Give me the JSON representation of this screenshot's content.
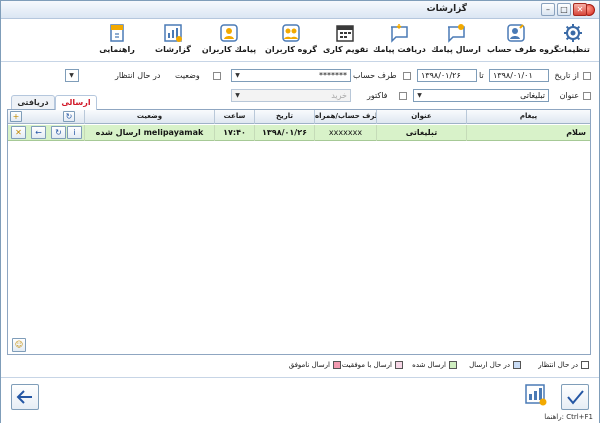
{
  "window": {
    "title": "گزارشات"
  },
  "toolbar": {
    "settings": "تنظیمات",
    "contact_groups": "گروه طرف حساب",
    "send_sms": "ارسال پیامك",
    "receive_sms": "دریافت پیامك",
    "calendar": "تقویم كاری",
    "user_groups": "گروه كاربران",
    "user_sms": "پیامك كاربران",
    "reports": "گزارشات",
    "help": "راهنمایی"
  },
  "filters": {
    "from_date_label": "از تاریخ",
    "from_date": "۱۳۹۸/۰۱/۰۱",
    "to_label": "تا",
    "to_date": "۱۳۹۸/۰۱/۲۶",
    "account_label": "طرف حساب",
    "account_value": "*******",
    "status_label": "وضعیت",
    "status_value": "در حال انتظار",
    "subject_label": "عنوان",
    "subject_value": "تبلیغاتی",
    "invoice_label": "فاكتور",
    "purchase_placeholder": "خرید"
  },
  "tabs": {
    "sent": "ارسالی",
    "received": "دریافتی"
  },
  "grid": {
    "columns": {
      "message": "پیغام",
      "subject": "عنوان",
      "account": "طرف حساب/همراه",
      "date": "تاریخ",
      "time": "ساعت",
      "status": "وضعیت"
    },
    "rows": [
      {
        "message": "سلام",
        "subject": "تبلیغاتی",
        "account": "xxxxxxx",
        "date": "۱۳۹۸/۰۱/۲۶",
        "time": "۱۷:۴۰",
        "status": "ارسال شده melipayamak"
      }
    ]
  },
  "legend": {
    "pending": "در حال انتظار",
    "sending": "در حال ارسال",
    "sent": "ارسال شده",
    "success": "ارسال با موفقیت",
    "failed": "ارسال ناموفق",
    "colors": {
      "pending": "#ffffff",
      "sending": "#c9dcf5",
      "sent": "#cfeec0",
      "success": "#f6d6e6",
      "failed": "#f39bb1"
    }
  },
  "bottom": {
    "hint": "راهنما: Ctrl+F1"
  }
}
